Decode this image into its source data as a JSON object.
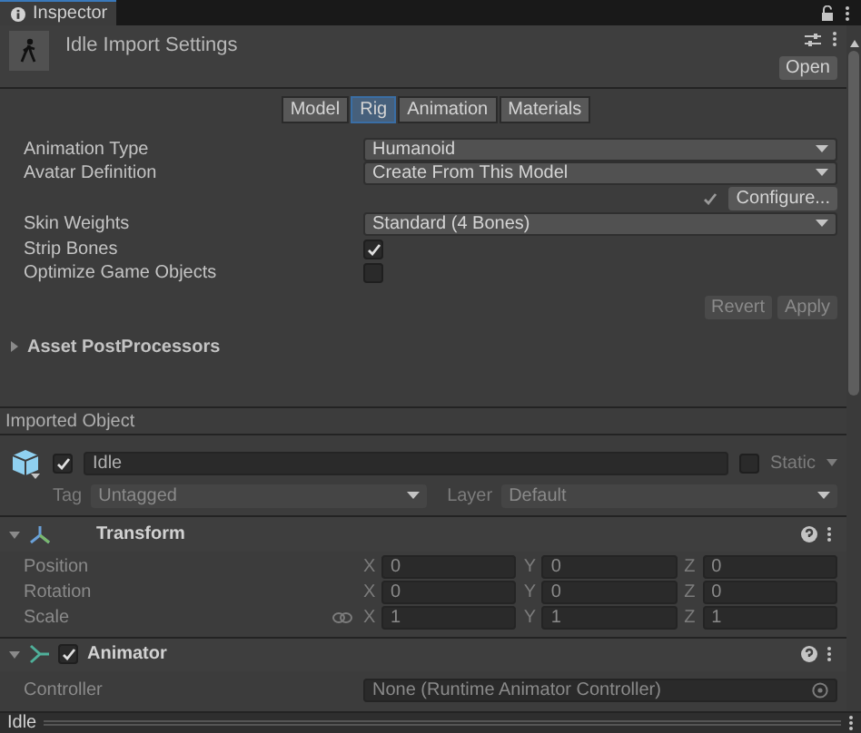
{
  "window": {
    "tab": "Inspector"
  },
  "header": {
    "title": "Idle Import Settings",
    "open_button": "Open"
  },
  "tabs": [
    {
      "label": "Model",
      "selected": false
    },
    {
      "label": "Rig",
      "selected": true
    },
    {
      "label": "Animation",
      "selected": false
    },
    {
      "label": "Materials",
      "selected": false
    }
  ],
  "rig_settings": [
    {
      "kind": "dropdown",
      "label": "Animation Type",
      "value": "Humanoid"
    },
    {
      "kind": "dropdown",
      "label": "Avatar Definition",
      "value": "Create From This Model"
    },
    {
      "kind": "action",
      "button": "Configure...",
      "checked": true
    },
    {
      "kind": "dropdown",
      "label": "Skin Weights",
      "value": "Standard (4 Bones)"
    },
    {
      "kind": "checkbox",
      "label": "Strip Bones",
      "checked": true
    },
    {
      "kind": "checkbox",
      "label": "Optimize Game Objects",
      "checked": false
    }
  ],
  "actions": [
    {
      "label": "Revert",
      "disabled": true
    },
    {
      "label": "Apply",
      "disabled": true
    }
  ],
  "foldout": {
    "label": "Asset PostProcessors",
    "expanded": false
  },
  "imported_object": {
    "section_title": "Imported Object",
    "active": true,
    "name": "Idle",
    "static_label": "Static",
    "static": false,
    "tag_label": "Tag",
    "tag": "Untagged",
    "layer_label": "Layer",
    "layer": "Default"
  },
  "components": [
    {
      "kind": "transform",
      "title": "Transform",
      "expanded": true,
      "rows": [
        {
          "kind": "vector",
          "label": "Position",
          "fields": [
            {
              "axis": "X",
              "value": "0"
            },
            {
              "axis": "Y",
              "value": "0"
            },
            {
              "axis": "Z",
              "value": "0"
            }
          ]
        },
        {
          "kind": "vector",
          "label": "Rotation",
          "fields": [
            {
              "axis": "X",
              "value": "0"
            },
            {
              "axis": "Y",
              "value": "0"
            },
            {
              "axis": "Z",
              "value": "0"
            }
          ]
        },
        {
          "kind": "scale",
          "label": "Scale",
          "fields": [
            {
              "axis": "X",
              "value": "1"
            },
            {
              "axis": "Y",
              "value": "1"
            },
            {
              "axis": "Z",
              "value": "1"
            }
          ]
        }
      ]
    },
    {
      "kind": "animator",
      "title": "Animator",
      "expanded": true,
      "enabled": true,
      "rows": [
        {
          "kind": "object",
          "label": "Controller",
          "value": "None (Runtime Animator Controller)"
        }
      ]
    }
  ],
  "status_bar": {
    "title": "Idle"
  }
}
